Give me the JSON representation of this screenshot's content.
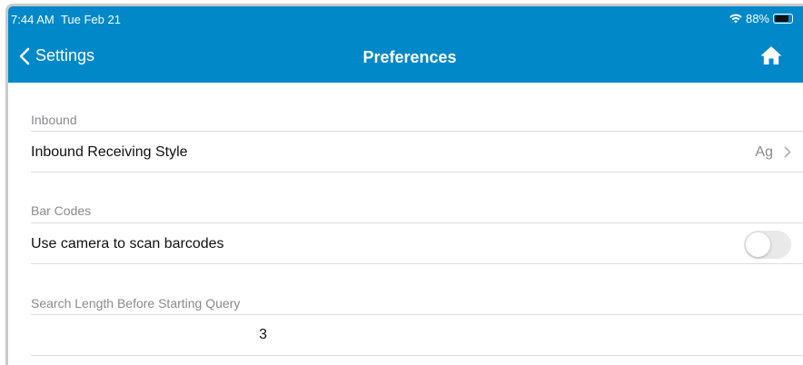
{
  "status_bar": {
    "time": "7:44 AM",
    "date": "Tue Feb 21",
    "battery": "88%"
  },
  "nav": {
    "back_label": "Settings",
    "title": "Preferences",
    "home_icon": "home-icon",
    "back_icon": "chevron-left-icon"
  },
  "sections": {
    "inbound": {
      "header": "Inbound",
      "row_label": "Inbound Receiving Style",
      "row_value": "Ag"
    },
    "barcodes": {
      "header": "Bar Codes",
      "row_label": "Use camera to scan barcodes",
      "toggle_on": false
    },
    "search": {
      "header": "Search Length Before Starting Query",
      "value": "3"
    }
  },
  "colors": {
    "header_bg": "#0088c8",
    "section_text": "#8a8a8e",
    "separator": "#dcdcdc"
  }
}
